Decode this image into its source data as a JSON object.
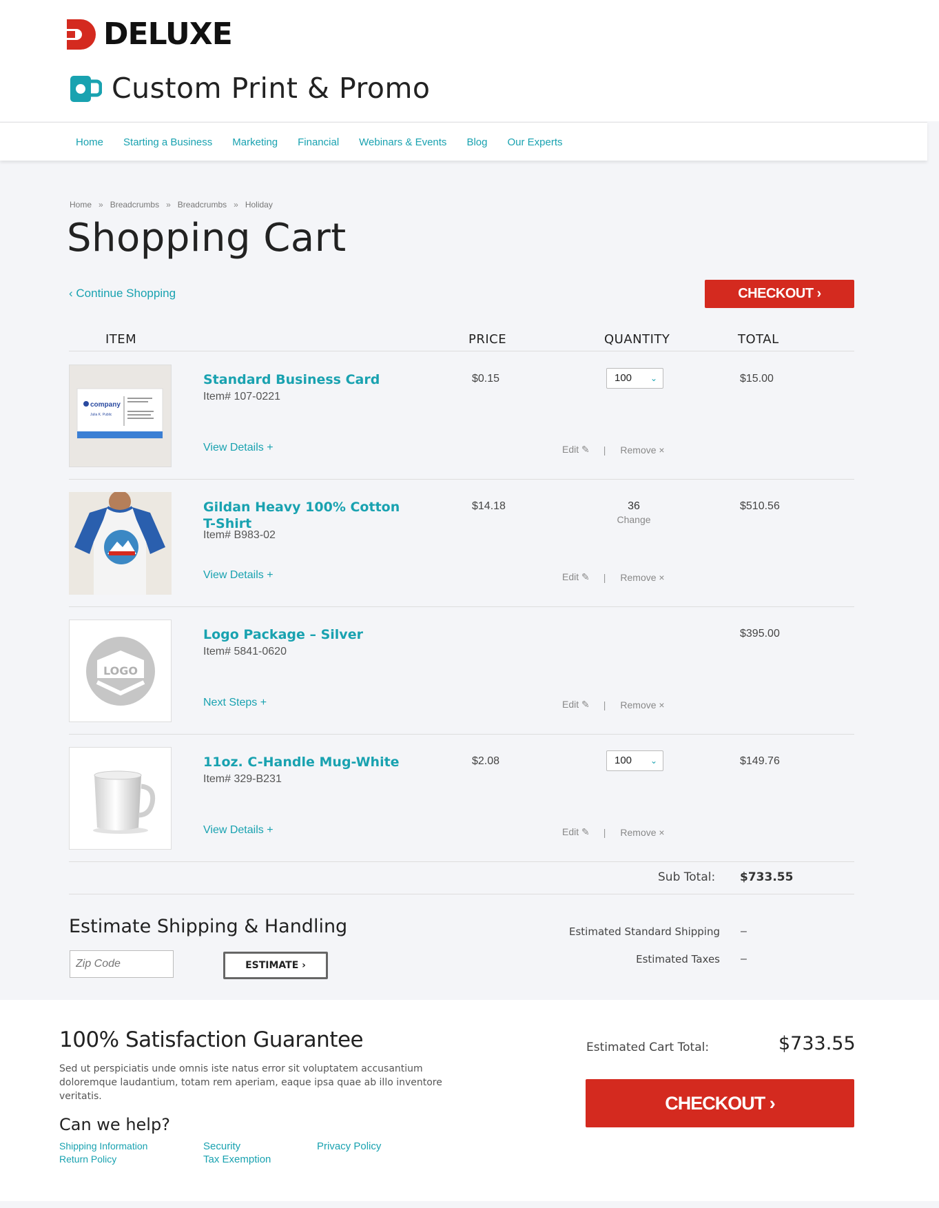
{
  "brand": {
    "name": "DELUXE",
    "sub": "Custom Print & Promo",
    "accent": "#19a2b0",
    "red": "#d42a1f"
  },
  "nav": [
    "Home",
    "Starting a Business",
    "Marketing",
    "Financial",
    "Webinars & Events",
    "Blog",
    "Our Experts"
  ],
  "breadcrumb": [
    "Home",
    "Breadcrumbs",
    "Breadcrumbs",
    "Holiday"
  ],
  "breadcrumb_sep": "»",
  "page_title": "Shopping Cart",
  "continue_label": "Continue Shopping",
  "checkout_label": "CHECKOUT",
  "columns": {
    "item": "ITEM",
    "price": "PRICE",
    "quantity": "QUANTITY",
    "total": "TOTAL"
  },
  "items": [
    {
      "name": "Standard Business Card",
      "item_no": "Item# 107-0221",
      "link": "View Details +",
      "price": "$0.15",
      "qty": "100",
      "total": "$15.00",
      "edit": "Edit",
      "remove": "Remove",
      "thumb": "business-card"
    },
    {
      "name": "Gildan Heavy 100% Cotton T-Shirt",
      "item_no": "Item# B983-02",
      "link": "View Details +",
      "price": "$14.18",
      "qty": "36",
      "qty_change": "Change",
      "total": "$510.56",
      "edit": "Edit",
      "remove": "Remove",
      "thumb": "t-shirt"
    },
    {
      "name": "Logo Package – Silver",
      "item_no": "Item# 5841-0620",
      "link": "Next Steps +",
      "price": "",
      "qty": "",
      "total": "$395.00",
      "edit": "Edit",
      "remove": "Remove",
      "thumb": "logo",
      "thumb_text": "LOGO"
    },
    {
      "name": "11oz. C-Handle Mug-White",
      "item_no": "Item# 329-B231",
      "link": "View Details +",
      "price": "$2.08",
      "qty": "100",
      "total": "$149.76",
      "edit": "Edit",
      "remove": "Remove",
      "thumb": "mug"
    }
  ],
  "card_thumb_text": {
    "company": "company",
    "person": "Julia K. Public"
  },
  "subtotal": {
    "label": "Sub Total:",
    "value": "$733.55"
  },
  "shipping": {
    "title": "Estimate Shipping & Handling",
    "zip_placeholder": "Zip Code",
    "estimate_label": "ESTIMATE",
    "standard_label": "Estimated Standard Shipping",
    "standard_value": "–",
    "taxes_label": "Estimated Taxes",
    "taxes_value": "–"
  },
  "footer": {
    "guarantee": "100% Satisfaction Guarantee",
    "lorem": "Sed ut perspiciatis unde omnis iste natus error sit voluptatem accusantium doloremque laudantium, totam rem aperiam, eaque ipsa quae ab illo inventore veritatis.",
    "help": "Can we help?",
    "links": {
      "shipping": "Shipping Information",
      "return": "Return Policy",
      "security": "Security",
      "tax": "Tax Exemption",
      "privacy": "Privacy Policy"
    },
    "cart_total_label": "Estimated Cart Total:",
    "cart_total_value": "$733.55"
  }
}
